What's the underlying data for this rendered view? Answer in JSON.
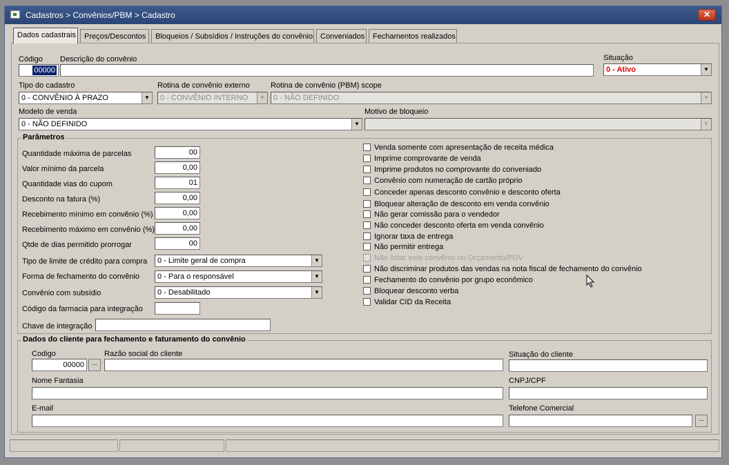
{
  "window": {
    "title": "Cadastros > Convênios/PBM > Cadastro",
    "close_label": "✕"
  },
  "tabs": [
    {
      "label": "Dados cadastrais"
    },
    {
      "label": "Preços/Descontos"
    },
    {
      "label": "Bloqueios / Subsídios / Instruções do convênio"
    },
    {
      "label": "Conveniados"
    },
    {
      "label": "Fechamentos realizados"
    }
  ],
  "header": {
    "codigo_label": "Código",
    "codigo_value": "00000",
    "descricao_label": "Descrição do convênio",
    "descricao_value": "",
    "situacao_label": "Situação",
    "situacao_value": "0 - Ativo",
    "tipo_label": "Tipo do cadastro",
    "tipo_value": "0 - CONVÊNIO À PRAZO",
    "rotina_externo_label": "Rotina de convênio externo",
    "rotina_externo_value": "0 - CONVÊNIO INTERNO",
    "rotina_pbm_label": "Rotina de convênio (PBM) scope",
    "rotina_pbm_value": "0 - NÃO DEFINIDO",
    "modelo_label": "Modelo de venda",
    "modelo_value": "0 - NÃO DEFINIDO",
    "motivo_label": "Motivo de bloqueio",
    "motivo_value": ""
  },
  "parametros": {
    "title": "Parâmetros",
    "fields": [
      {
        "label": "Quantidade máxima de parcelas",
        "value": "00"
      },
      {
        "label": "Valor mínimo da parcela",
        "value": "0,00"
      },
      {
        "label": "Quantidade vias do cupom",
        "value": "01"
      },
      {
        "label": "Desconto na fatura (%)",
        "value": "0,00"
      },
      {
        "label": "Recebimento mínimo em convênio (%)",
        "value": "0,00"
      },
      {
        "label": "Recebimento máximo em convênio (%)",
        "value": "0,00"
      },
      {
        "label": "Qtde de dias permitido prorrogar",
        "value": "00"
      }
    ],
    "tipo_limite_label": "Tipo de limite de crédito para compra",
    "tipo_limite_value": "0 - Limite geral de compra",
    "forma_fechamento_label": "Forma de fechamento do convênio",
    "forma_fechamento_value": "0 - Para o responsável",
    "subsidio_label": "Convênio com subsídio",
    "subsidio_value": "0 - Desabilitado",
    "codigo_farmacia_label": "Código da farmacia para integração",
    "codigo_farmacia_value": "",
    "chave_label": "Chave de integração",
    "chave_value": "",
    "checkboxes": [
      {
        "label": "Venda somente com apresentação de receita médica"
      },
      {
        "label": "Imprime comprovante de venda"
      },
      {
        "label": "Imprime produtos no comprovante do conveniado"
      },
      {
        "label": "Convênio com numeração de cartão próprio"
      },
      {
        "label": "Conceder apenas desconto convênio e desconto oferta"
      },
      {
        "label": "Bloquear alteração de desconto em venda convênio"
      },
      {
        "label": "Não gerar comissão para o vendedor"
      },
      {
        "label": "Não conceder desconto oferta em venda convênio"
      },
      {
        "label": "Ignorar taxa de entrega"
      },
      {
        "label": "Não permitir entrega"
      },
      {
        "label": "Não listar este convênio no Orçamento/PDV"
      },
      {
        "label": "Não discriminar produtos das vendas na nota fiscal de fechamento do convênio"
      },
      {
        "label": "Fechamento do convênio por grupo econômico"
      },
      {
        "label": "Bloquear desconto verba"
      },
      {
        "label": "Validar CID da Receita"
      }
    ]
  },
  "cliente": {
    "title": "Dados do cliente para fechamento e faturamento do convênio",
    "codigo_label": "Codigo",
    "codigo_value": "00000",
    "dots_label": "...",
    "razao_label": "Razão social do cliente",
    "razao_value": "",
    "situacao_label": "Situação do cliente",
    "situacao_value": "",
    "fantasia_label": "Nome Fantasia",
    "fantasia_value": "",
    "cnpj_label": "CNPJ/CPF",
    "cnpj_value": "",
    "email_label": "E-mail",
    "email_value": "",
    "telefone_label": "Telefone Comercial",
    "telefone_value": ""
  },
  "icons": {
    "app": "app-window-icon",
    "dropdown": "chevron-down-icon",
    "close": "close-icon"
  }
}
